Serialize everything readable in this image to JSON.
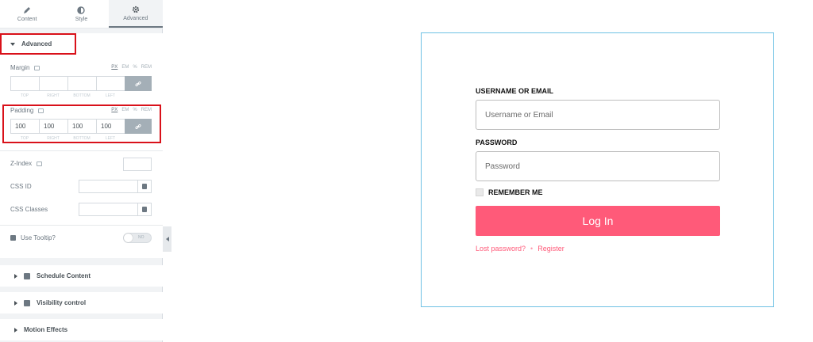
{
  "tabs": [
    {
      "label": "Content",
      "icon": "pencil-icon"
    },
    {
      "label": "Style",
      "icon": "half-circle-icon"
    },
    {
      "label": "Advanced",
      "icon": "gear-icon"
    }
  ],
  "advanced": {
    "title": "Advanced",
    "units": [
      "PX",
      "EM",
      "%",
      "REM"
    ],
    "margin": {
      "label": "Margin",
      "values": [
        "",
        "",
        "",
        ""
      ]
    },
    "padding": {
      "label": "Padding",
      "values": [
        "100",
        "100",
        "100",
        "100"
      ]
    },
    "dim_labels": [
      "TOP",
      "RIGHT",
      "BOTTOM",
      "LEFT"
    ],
    "z_index": {
      "label": "Z-Index",
      "value": ""
    },
    "css_id": {
      "label": "CSS ID",
      "value": ""
    },
    "css_classes": {
      "label": "CSS Classes",
      "value": ""
    },
    "tooltip": {
      "label": "Use Tooltip?",
      "toggle_text": "NO",
      "enabled": false
    }
  },
  "sections": [
    "Schedule Content",
    "Visibility control",
    "Motion Effects"
  ],
  "login": {
    "username_label": "USERNAME OR EMAIL",
    "username_placeholder": "Username or Email",
    "password_label": "PASSWORD",
    "password_placeholder": "Password",
    "remember_label": "REMEMBER ME",
    "button_label": "Log In",
    "lost_password": "Lost password?",
    "separator": "•",
    "register": "Register"
  },
  "colors": {
    "accent": "#ff5a79",
    "highlight": "#d9111a",
    "frame": "#6ec1e4"
  }
}
